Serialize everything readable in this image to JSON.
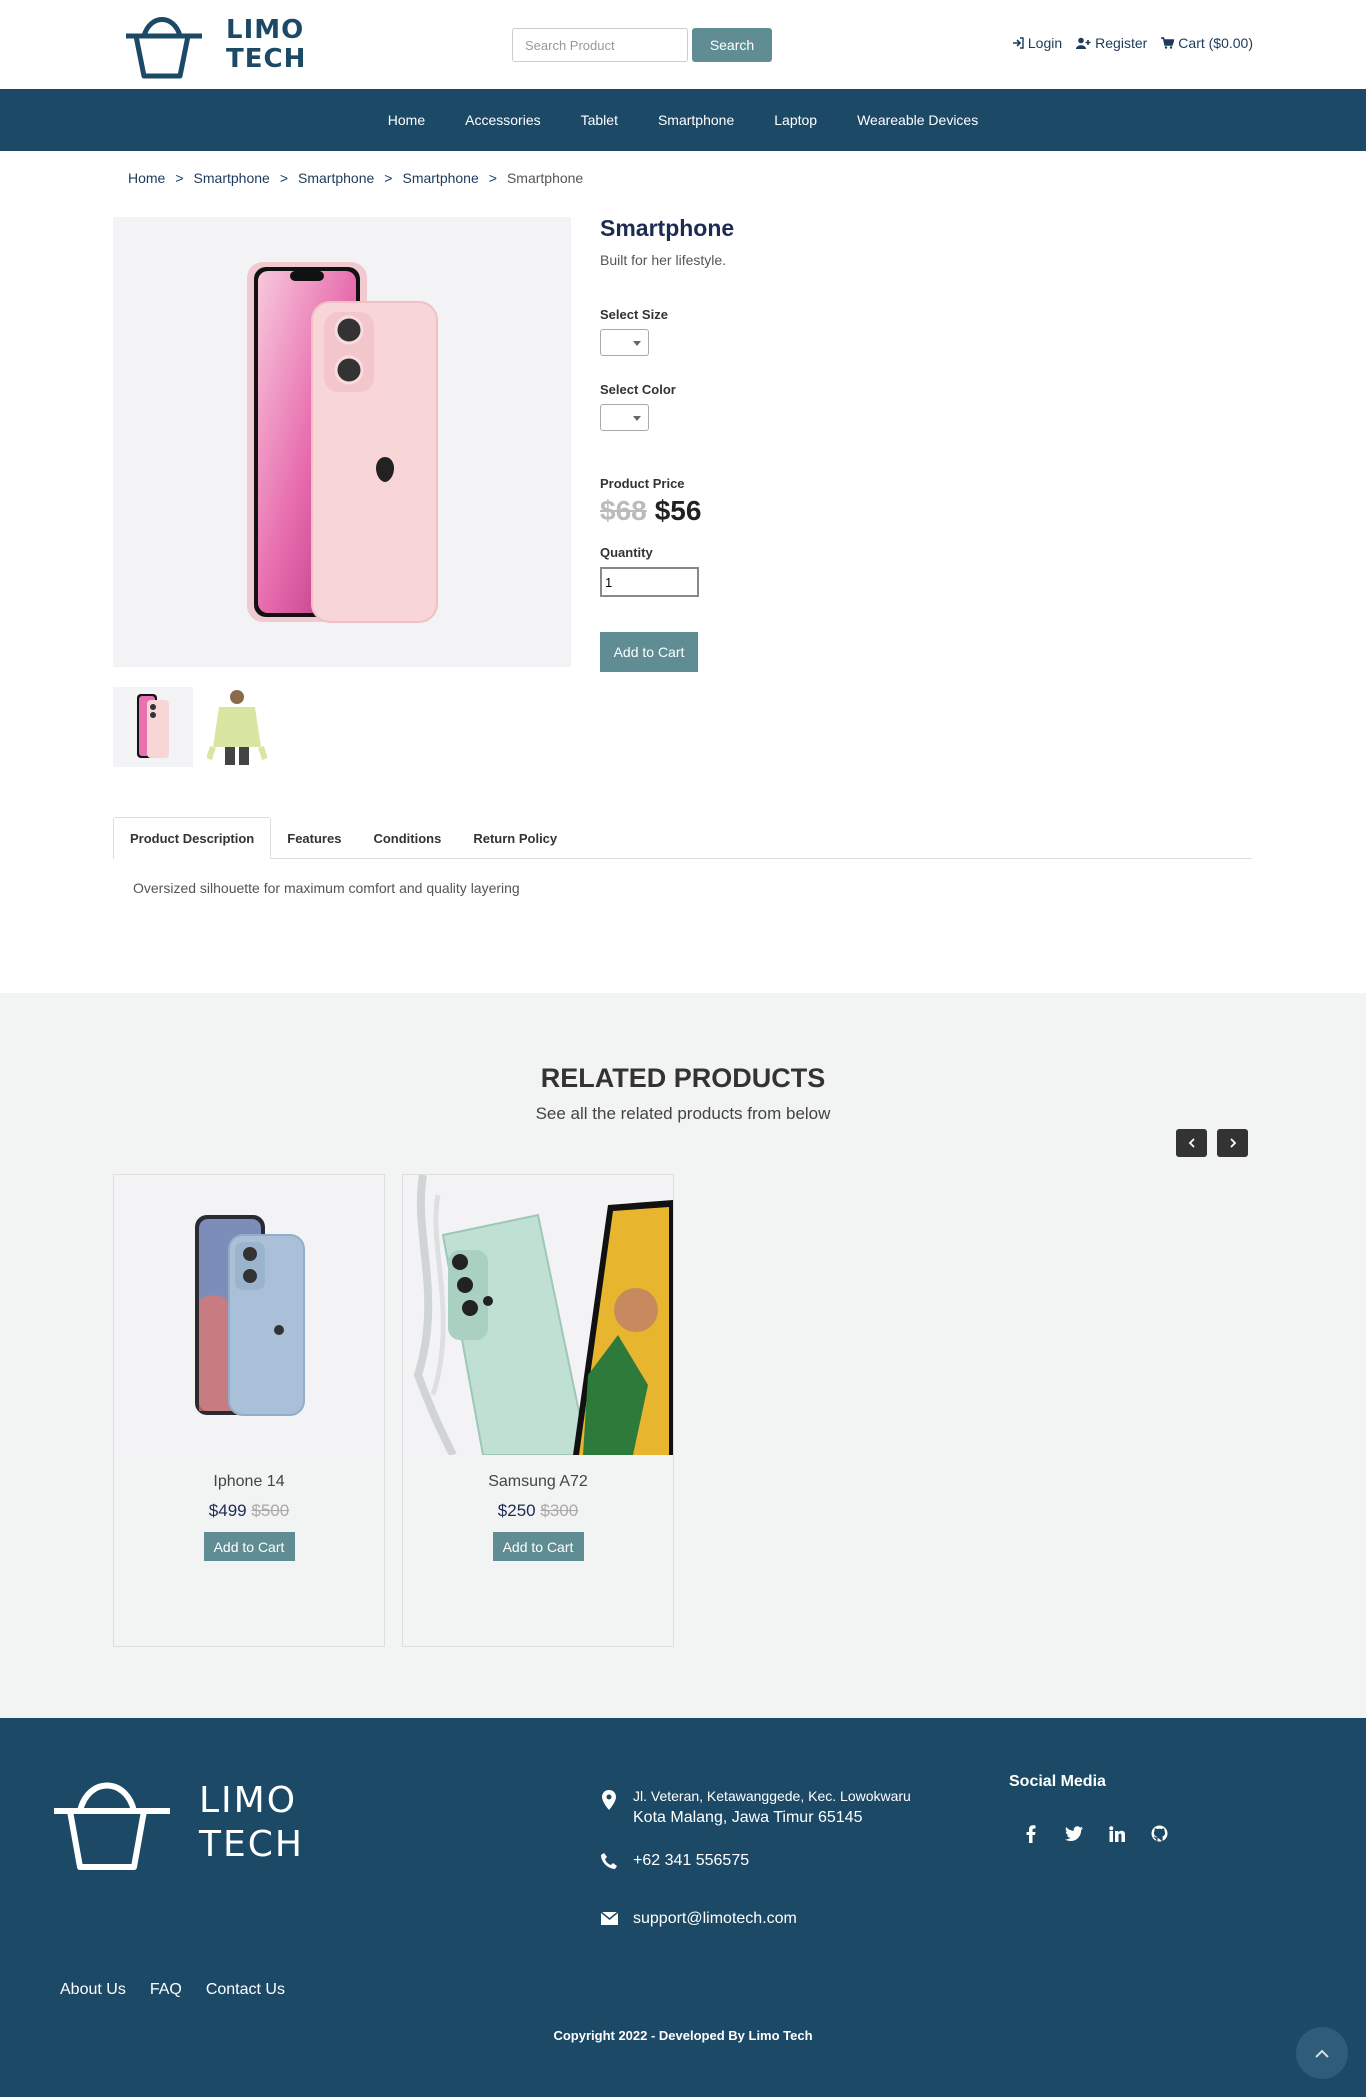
{
  "brand": {
    "name_line1": "LIMO",
    "name_line2": "TECH",
    "primary_color": "#1c4966",
    "accent_color": "#5f8d93"
  },
  "search": {
    "placeholder": "Search Product",
    "button_label": "Search"
  },
  "header_links": {
    "login": "Login",
    "register": "Register",
    "cart": "Cart ($0.00)"
  },
  "nav": [
    "Home",
    "Accessories",
    "Tablet",
    "Smartphone",
    "Laptop",
    "Weareable Devices"
  ],
  "breadcrumb": [
    "Home",
    "Smartphone",
    "Smartphone",
    "Smartphone",
    "Smartphone"
  ],
  "breadcrumb_separator": ">",
  "product": {
    "title": "Smartphone",
    "tagline": "Built for her lifestyle.",
    "size_label": "Select Size",
    "color_label": "Select Color",
    "price_label": "Product Price",
    "old_price": "$68",
    "new_price": "$56",
    "quantity_label": "Quantity",
    "quantity_value": "1",
    "add_to_cart": "Add to Cart"
  },
  "tabs": [
    "Product Description",
    "Features",
    "Conditions",
    "Return Policy"
  ],
  "tab_content": "Oversized silhouette for maximum comfort and quality layering",
  "related": {
    "title": "RELATED PRODUCTS",
    "subtitle": "See all the related products from below",
    "items": [
      {
        "name": "Iphone 14",
        "price": "$499",
        "old_price": "$500",
        "button": "Add to Cart"
      },
      {
        "name": "Samsung A72",
        "price": "$250",
        "old_price": "$300",
        "button": "Add to Cart"
      }
    ]
  },
  "footer": {
    "address_line1": "Jl. Veteran, Ketawanggede, Kec. Lowokwaru",
    "address_line2": "Kota Malang, Jawa Timur 65145",
    "phone": "+62 341 556575",
    "email": "support@limotech.com",
    "social_title": "Social Media",
    "links": [
      "About Us",
      "FAQ",
      "Contact Us"
    ],
    "copyright": "Copyright 2022 - Developed By Limo Tech"
  }
}
